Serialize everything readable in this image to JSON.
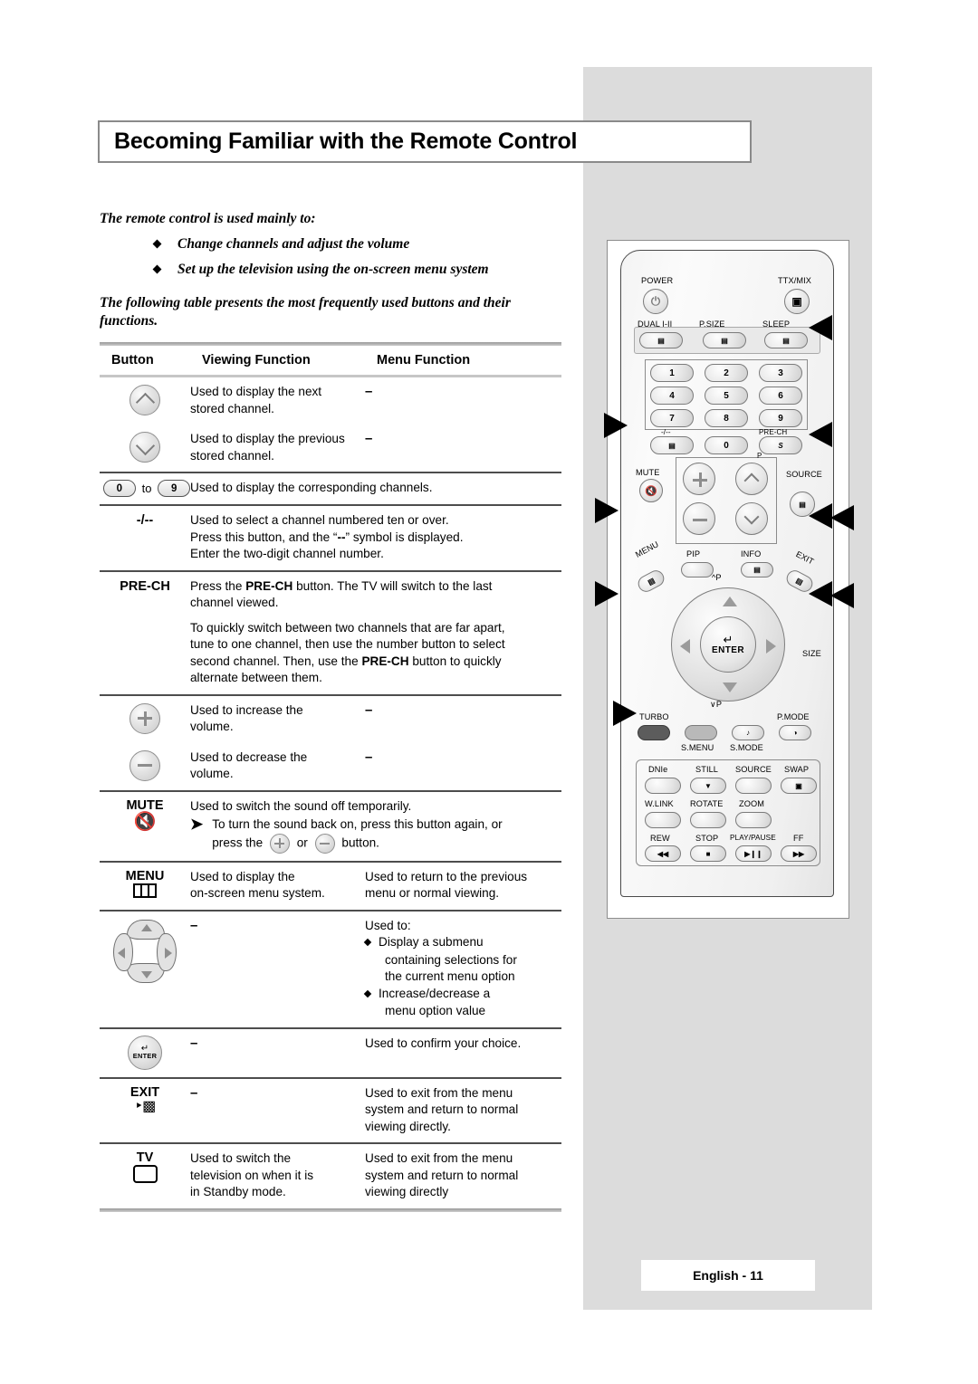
{
  "page": {
    "title": "Becoming Familiar with the Remote Control",
    "footer": "English - 11"
  },
  "intro": {
    "lead": "The remote control is used mainly to:",
    "bullets": [
      "Change channels and adjust the volume",
      "Set up the television using the on-screen menu system"
    ],
    "paragraph": "The following table presents the most frequently used buttons and their functions."
  },
  "table": {
    "headers": {
      "button": "Button",
      "viewing": "Viewing Function",
      "menu": "Menu Function"
    },
    "dash": "–",
    "rows": {
      "ch_up": {
        "viewing_line1": "Used to display the next",
        "viewing_line2": "stored channel.",
        "menu": "–"
      },
      "ch_down": {
        "viewing_line1": "Used to display the previous",
        "viewing_line2": "stored channel.",
        "menu": "–"
      },
      "numbers": {
        "label_from": "0",
        "label_to": "9",
        "connector": "to",
        "viewing": "Used to display the corresponding channels."
      },
      "dash_slash": {
        "label": "-/--",
        "line1": "Used to select a channel numbered ten or over.",
        "line2_a": "Press this button, and the “",
        "line2_b": "--",
        "line2_c": "” symbol is displayed.",
        "line3": "Enter the two-digit channel number."
      },
      "pre_ch": {
        "label": "PRE-CH",
        "p1_a": "Press the ",
        "p1_b": "PRE-CH",
        "p1_c": " button. The TV will switch to the last",
        "p1_d": "channel viewed.",
        "p2_l1": "To quickly switch between two channels that are far apart,",
        "p2_l2": "tune to one channel, then use the number button to select",
        "p2_l3_a": "second channel. Then, use the ",
        "p2_l3_b": "PRE-CH",
        "p2_l3_c": " button to quickly",
        "p2_l4": "alternate between them."
      },
      "vol_up": {
        "viewing_line1": "Used to increase the",
        "viewing_line2": "volume.",
        "menu": "–"
      },
      "vol_down": {
        "viewing_line1": "Used to decrease the",
        "viewing_line2": "volume.",
        "menu": "–"
      },
      "mute": {
        "label": "MUTE",
        "viewing": "Used to switch the sound off temporarily.",
        "note_l1": "To turn the sound back on, press this button again, or",
        "note_l2_a": "press the",
        "note_l2_b": "or",
        "note_l2_c": "button."
      },
      "menu": {
        "label": "MENU",
        "viewing_line1": "Used to display the",
        "viewing_line2": "on-screen menu system.",
        "menu_line1": "Used to return to the previous",
        "menu_line2": "menu or normal viewing."
      },
      "updown_leftright": {
        "viewing": "–",
        "menu_head": "Used to:",
        "menu_items": [
          [
            "Display a submenu",
            "containing selections for",
            "the current menu option"
          ],
          [
            "Increase/decrease a",
            "menu option value"
          ]
        ]
      },
      "enter": {
        "icon_label": "ENTER",
        "viewing": "–",
        "menu": "Used to confirm your choice."
      },
      "exit": {
        "label": "EXIT",
        "viewing": "–",
        "menu_l1": "Used to exit from the menu",
        "menu_l2": "system and return to normal",
        "menu_l3": "viewing directly."
      },
      "tv": {
        "label": "TV",
        "viewing_l1": "Used to switch the",
        "viewing_l2": "television on when it is",
        "viewing_l3": "in Standby mode.",
        "menu_l1": "Used to exit from the menu",
        "menu_l2": "system and return to normal",
        "menu_l3": "viewing directly"
      }
    }
  },
  "remote": {
    "labels": {
      "power": "POWER",
      "ttx_mix": "TTX/MIX",
      "dual": "DUAL I-II",
      "psize": "P.SIZE",
      "sleep": "SLEEP",
      "minus_slash": "-/--",
      "pre_ch": "PRE-CH",
      "mute": "MUTE",
      "source": "SOURCE",
      "p_channel": "P",
      "pip": "PIP",
      "info": "INFO",
      "menu": "MENU",
      "exit": "EXIT",
      "size": "SIZE",
      "up_p": "^P",
      "down_p": "∨P",
      "enter": "ENTER",
      "turbo": "TURBO",
      "s_menu": "S.MENU",
      "s_mode": "S.MODE",
      "p_mode": "P.MODE",
      "dnie": "DNIe",
      "still": "STILL",
      "source2": "SOURCE",
      "swap": "SWAP",
      "wlink": "W.LINK",
      "rotate": "ROTATE",
      "zoom": "ZOOM",
      "rew": "REW",
      "stop": "STOP",
      "play_pause": "PLAY/PAUSE",
      "ff": "FF"
    },
    "numpad": [
      "1",
      "2",
      "3",
      "4",
      "5",
      "6",
      "7",
      "8",
      "9",
      "0"
    ]
  },
  "colors": {
    "panel_gray": "#dcdcdc",
    "title_border": "#8a8a8a",
    "rule_dark": "#4d4d4d",
    "key_border": "#7b7b7b"
  }
}
